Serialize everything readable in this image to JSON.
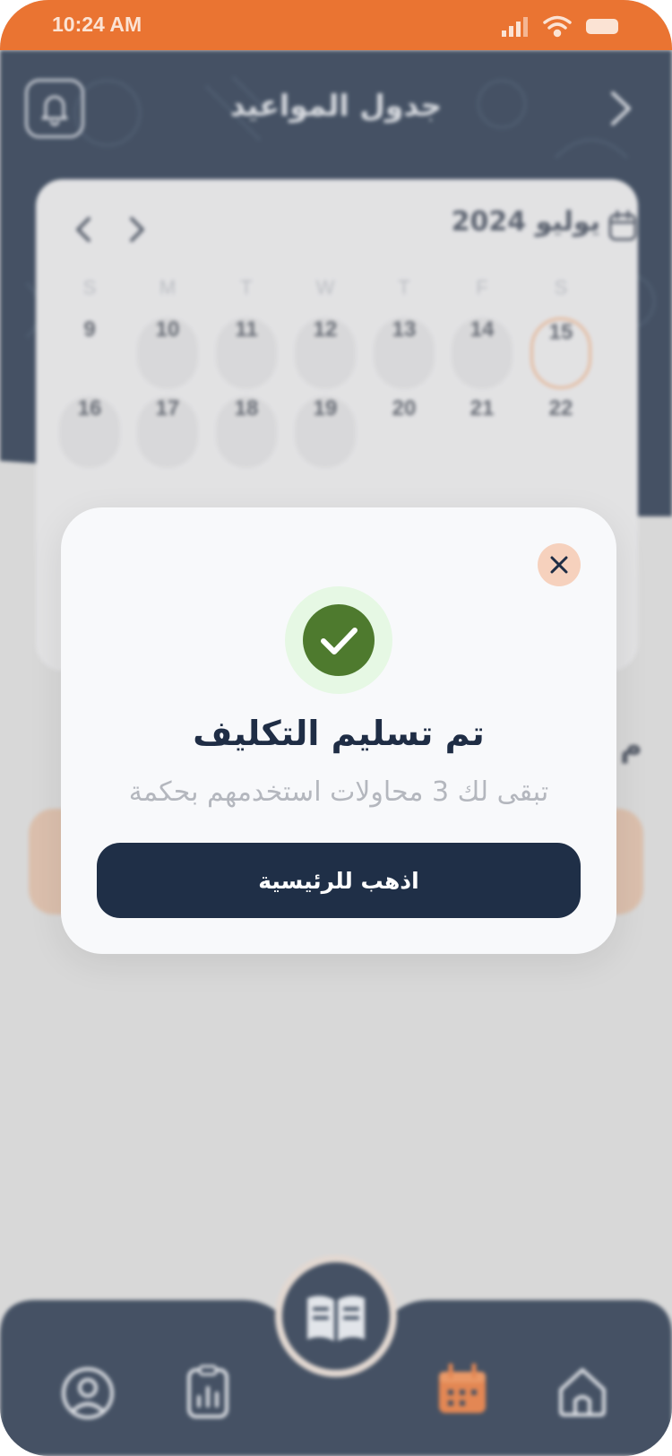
{
  "status_bar": {
    "time": "10:24 AM",
    "background_color": "#ea7432"
  },
  "header": {
    "title": "جدول المواعيد",
    "left_icon": "bell-icon",
    "right_icon": "chevron-right-icon"
  },
  "calendar": {
    "month_label": "يوليو 2024",
    "icon": "calendar-icon",
    "weekdays": [
      "S",
      "M",
      "T",
      "W",
      "T",
      "F",
      "S"
    ],
    "week1": [
      "9",
      "10",
      "11",
      "12",
      "13",
      "14",
      "15"
    ],
    "week2": [
      "16",
      "17",
      "18",
      "19",
      "20",
      "21",
      "22"
    ],
    "selected_day": "15"
  },
  "background_snippet": {
    "peek_text": "م"
  },
  "modal": {
    "close_icon": "close-icon",
    "success_icon": "check-icon",
    "title": "تم تسليم التكليف",
    "subtitle": "تبقى لك 3 محاولات استخدمهم بحكمة",
    "button_label": "اذهب للرئيسية"
  },
  "bottom_nav": {
    "items": [
      "profile-icon",
      "report-icon",
      "book-icon",
      "calendar-icon",
      "home-icon"
    ],
    "active": "calendar-icon",
    "accent_color": "#ea7432",
    "dark_color": "#1f2f47"
  }
}
